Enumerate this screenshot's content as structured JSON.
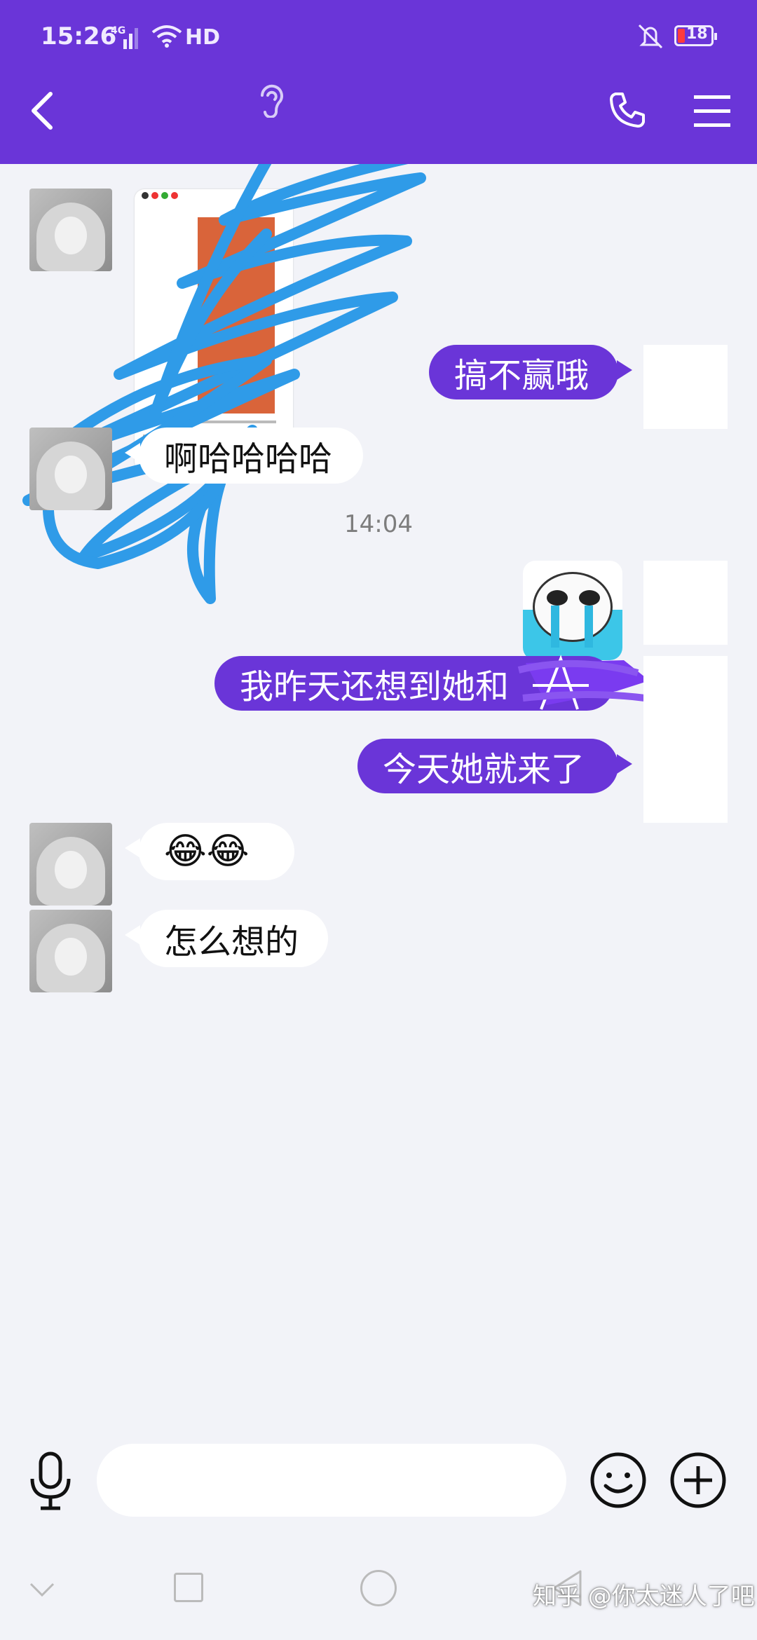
{
  "status_bar": {
    "time": "15:26",
    "network": "4G",
    "hd_label": "HD",
    "battery": "18"
  },
  "header": {
    "icons": [
      "back-icon",
      "ear-icon",
      "phone-icon",
      "menu-icon"
    ]
  },
  "messages": [
    {
      "direction": "incoming",
      "type": "image"
    },
    {
      "direction": "outgoing",
      "type": "text",
      "text": "搞不赢哦"
    },
    {
      "direction": "incoming",
      "type": "text",
      "text": "啊哈哈哈哈"
    },
    {
      "type": "time",
      "text": "14:04"
    },
    {
      "direction": "outgoing",
      "type": "sticker"
    },
    {
      "direction": "outgoing",
      "type": "text",
      "text": "我昨天还想到她和"
    },
    {
      "direction": "outgoing",
      "type": "text",
      "text": "今天她就来了"
    },
    {
      "direction": "incoming",
      "type": "text",
      "text": "😂😂"
    },
    {
      "direction": "incoming",
      "type": "text",
      "text": "怎么想的"
    }
  ],
  "input": {
    "placeholder": ""
  },
  "watermark": "知乎 @你太迷人了吧",
  "colors": {
    "accent": "#6a35d8",
    "background": "#f2f3f8",
    "scribble": "#2f9be8"
  }
}
